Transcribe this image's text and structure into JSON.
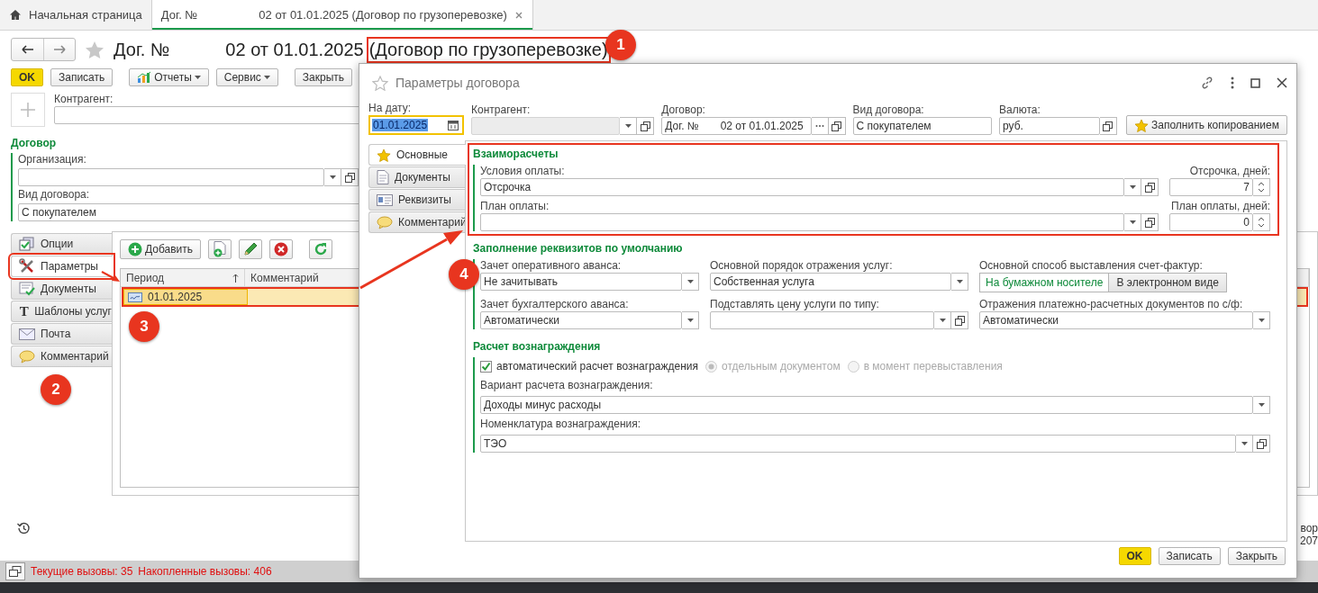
{
  "tabs": [
    {
      "kind": "home",
      "label": "Начальная страница",
      "selected": false
    },
    {
      "kind": "document",
      "label": "Дог. №",
      "label_2": "02 от 01.01.2025 (Договор по грузоперевозке)",
      "selected": true
    }
  ],
  "form": {
    "title": {
      "prefix": "Дог. №",
      "number": "02 от 01.01.2025",
      "suffix": "(Договор по грузоперевозке)",
      "suffix_highlighted": true
    },
    "toolbar": [
      {
        "kind": "default",
        "label": "OK"
      },
      {
        "kind": "plain",
        "label": "Записать"
      },
      {
        "kind": "report",
        "label": "Отчеты"
      },
      {
        "kind": "menu",
        "label": "Сервис"
      },
      {
        "kind": "plain",
        "label": "Закрыть"
      }
    ],
    "counterparty": {
      "label": "Контрагент:"
    },
    "contract_group": {
      "title": "Договор",
      "organization": {
        "label": "Организация:"
      },
      "contract_type": {
        "label": "Вид договора:",
        "value": "С покупателем"
      }
    },
    "side_tabs": [
      {
        "kind": "options",
        "label": "Опции",
        "selected": false,
        "highlighted": false
      },
      {
        "kind": "params",
        "label": "Параметры",
        "selected": true,
        "highlighted": true
      },
      {
        "kind": "docs",
        "label": "Документы",
        "selected": false,
        "highlighted": false
      },
      {
        "kind": "letter",
        "glyph": "T",
        "label": "Шаблоны услуг",
        "selected": false,
        "highlighted": false
      },
      {
        "kind": "mail",
        "label": "Почта",
        "selected": false,
        "highlighted": false
      },
      {
        "kind": "comment",
        "label": "Комментарий",
        "selected": false,
        "highlighted": false
      }
    ],
    "period_toolbar": [
      {
        "kind": "add",
        "label": "Добавить"
      },
      {
        "kind": "copy"
      },
      {
        "kind": "edit"
      },
      {
        "kind": "delete"
      },
      {
        "kind": "refresh"
      }
    ],
    "period_table": {
      "columns": [
        {
          "label": "Период",
          "sorted": true
        },
        {
          "label": "Комментарий",
          "sorted": false
        }
      ],
      "rows": [
        {
          "period": "01.01.2025",
          "selected": true,
          "highlighted": true
        }
      ]
    },
    "edge_text": [
      "вор",
      "207"
    ]
  },
  "status_bar": {
    "current": "Текущие вызовы: 35",
    "accumulated": "Накопленные вызовы: 406"
  },
  "dialog": {
    "title": "Параметры договора",
    "header_fields": [
      {
        "kind": "date",
        "label": "На дату:",
        "value": "01.01.2025",
        "focused": true
      },
      {
        "kind": "select",
        "label": "Контрагент:",
        "disabled": true
      },
      {
        "kind": "contract",
        "label": "Договор:",
        "value": "Дог. №",
        "value_2": "02 от 01.01.2025"
      },
      {
        "kind": "text",
        "label": "Вид договора:",
        "value": "С покупателем"
      },
      {
        "kind": "open",
        "label": "Валюта:",
        "value": "руб."
      }
    ],
    "fill_button": "Заполнить копированием",
    "tabs": [
      {
        "kind": "main",
        "label": "Основные",
        "selected": true
      },
      {
        "kind": "docs",
        "label": "Документы",
        "selected": false
      },
      {
        "kind": "card",
        "label": "Реквизиты",
        "selected": false
      },
      {
        "kind": "comment",
        "label": "Комментарий",
        "selected": false
      }
    ],
    "settlements": {
      "title": "Взаиморасчеты",
      "highlighted": true,
      "payment_terms": {
        "label": "Условия оплаты:",
        "value": "Отсрочка"
      },
      "deferral": {
        "label": "Отсрочка, дней:",
        "value": "7"
      },
      "payment_plan": {
        "label": "План оплаты:"
      },
      "plan_days": {
        "label": "План оплаты, дней:",
        "value": "0"
      }
    },
    "defaults": {
      "title": "Заполнение реквизитов по умолчанию",
      "fields": [
        {
          "kind": "select",
          "label": "Зачет оперативного аванса:",
          "value": "Не зачитывать"
        },
        {
          "kind": "select",
          "label": "Основной порядок отражения услуг:",
          "value": "Собственная услуга"
        },
        {
          "kind": "toggle",
          "label": "Основной способ выставления счет-фактур:",
          "options": [
            {
              "label": "На бумажном носителе",
              "selected": true
            },
            {
              "label": "В электронном виде",
              "selected": false
            }
          ]
        },
        {
          "kind": "select",
          "label": "Зачет бухгалтерского аванса:",
          "value": "Автоматически"
        },
        {
          "kind": "select-open",
          "label": "Подставлять цену услуги по типу:"
        },
        {
          "kind": "select",
          "label": "Отражения платежно-расчетных документов по с/ф:",
          "value": "Автоматически"
        }
      ]
    },
    "reward": {
      "title": "Расчет вознаграждения",
      "auto": {
        "label": "автоматический расчет вознаграждения",
        "checked": true
      },
      "modes": [
        {
          "label": "отдельным документом",
          "selected": true,
          "disabled": true
        },
        {
          "label": "в момент перевыставления",
          "selected": false,
          "disabled": true
        }
      ],
      "variant": {
        "label": "Вариант расчета вознаграждения:",
        "value": "Доходы минус расходы"
      },
      "nomenclature": {
        "label": "Номенклатура вознаграждения:",
        "value": "ТЭО"
      }
    },
    "footer": [
      {
        "kind": "default",
        "label": "OK"
      },
      {
        "kind": "plain",
        "label": "Записать"
      },
      {
        "kind": "plain",
        "label": "Закрыть"
      }
    ]
  },
  "markers": [
    "1",
    "2",
    "3",
    "4"
  ]
}
